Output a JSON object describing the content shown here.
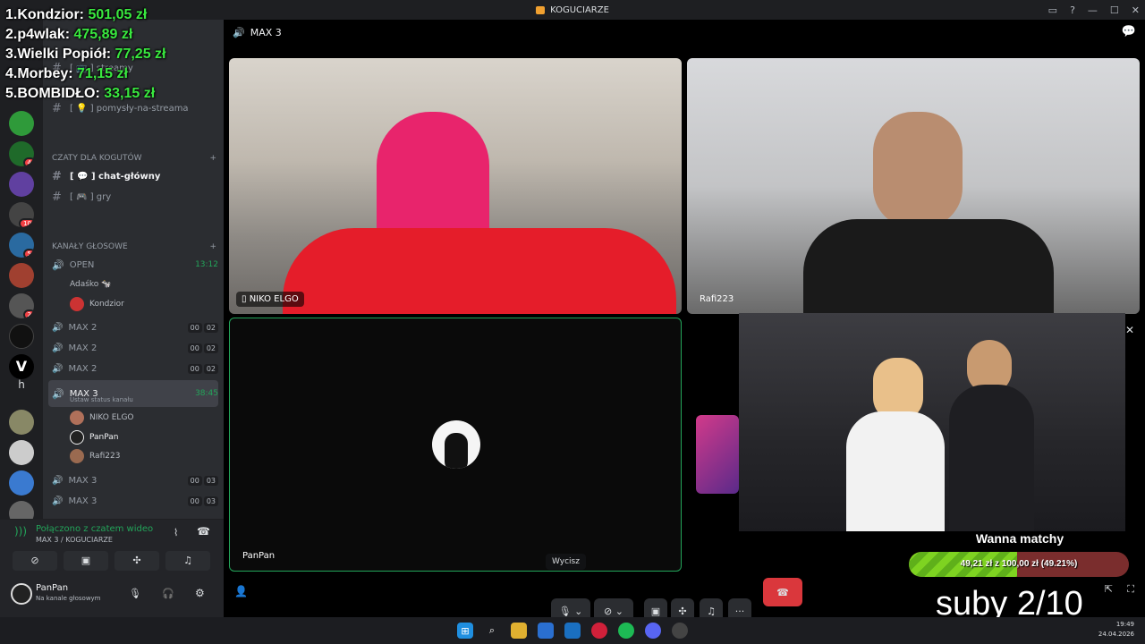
{
  "window": {
    "title": "KOGUCIARZE"
  },
  "overlay": {
    "ranking": [
      {
        "rank": "1.",
        "name": "Kondzior:",
        "amount": "501,05 zł"
      },
      {
        "rank": "2.",
        "name": "p4wlak:",
        "amount": "475,89 zł"
      },
      {
        "rank": "3.",
        "name": "Wielki Popiół:",
        "amount": "77,25 zł"
      },
      {
        "rank": "4.",
        "name": "Morbey:",
        "amount": "71,15 zł"
      },
      {
        "rank": "5.",
        "name": "BOMBIDŁO:",
        "amount": "33,15 zł"
      }
    ],
    "goal_title": "Wanna matchy",
    "goal_progress_text": "49,21 zł z 100,00 zł (49.21%)",
    "goal_progress": 0.4921,
    "subs_text": "suby 2/10"
  },
  "sidebar": {
    "channels_top": [
      {
        "label": "[ 📺 ] streamy"
      },
      {
        "label": "[ 💡 ] pomysły-na-streama"
      }
    ],
    "category_chats": "CZATY DLA KOGUTÓW",
    "chat_channels": [
      {
        "label": "[ 💬 ] chat-główny"
      },
      {
        "label": "[ 🎮 ] gry"
      }
    ],
    "category_voice": "KANAŁY GŁOSOWE",
    "voice_open": {
      "label": "OPEN",
      "timer": "13:12",
      "members": [
        "Adaśko 🐄",
        "Kondzior"
      ]
    },
    "voice_channels": [
      {
        "label": "MAX 2",
        "c1": "00",
        "c2": "02"
      },
      {
        "label": "MAX 2",
        "c1": "00",
        "c2": "02"
      },
      {
        "label": "MAX 2",
        "c1": "00",
        "c2": "02"
      }
    ],
    "voice_current": {
      "label": "MAX 3",
      "timer": "38:45",
      "status": "Ustaw status kanału",
      "members": [
        "NIKO ELGO",
        "PanPan",
        "Rafi223"
      ]
    },
    "voice_channels_bottom": [
      {
        "label": "MAX 3",
        "c1": "00",
        "c2": "03"
      },
      {
        "label": "MAX 3",
        "c1": "00",
        "c2": "03"
      }
    ],
    "server_letter": "h"
  },
  "voice_panel": {
    "status": "Połączono z czatem wideo",
    "location": "MAX 3 / KOGUCIARZE"
  },
  "user": {
    "name": "PanPan",
    "status": "Na kanale głosowym"
  },
  "stage": {
    "channel_name": "MAX 3",
    "tiles": [
      "NIKO ELGO",
      "Rafi223",
      "PanPan"
    ],
    "tooltip": "Wycisz"
  },
  "clock": {
    "time": "19:49",
    "date": "24.04.2026"
  },
  "colors": {
    "accent_green": "#23a55a",
    "danger": "#da373c",
    "overlay_green": "#39e83f"
  }
}
